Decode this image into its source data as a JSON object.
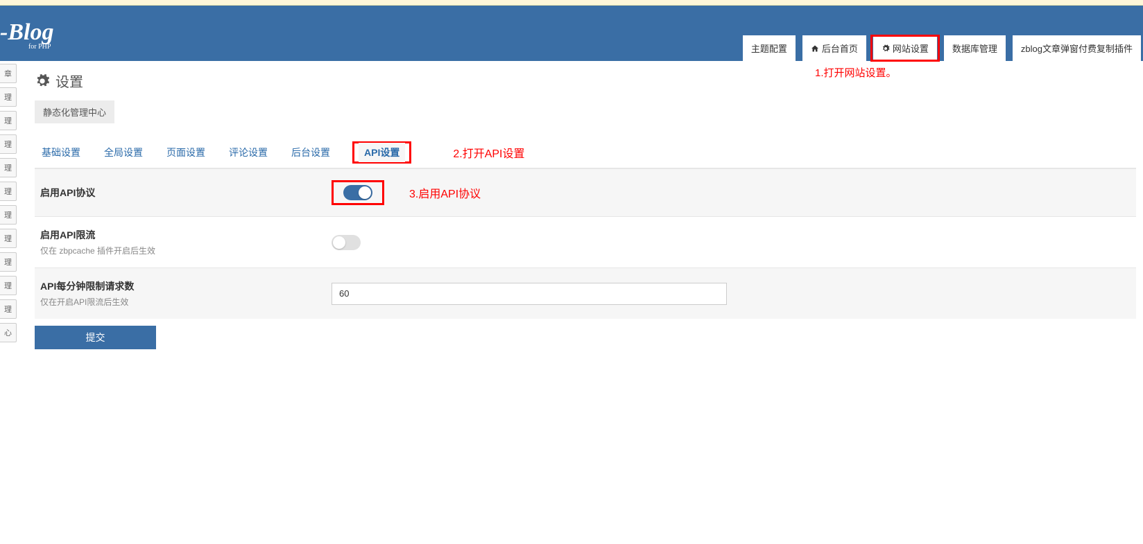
{
  "logo": {
    "main": "-Blog",
    "sub": "for PHP"
  },
  "topnav": [
    {
      "label": "主题配置",
      "icon": null
    },
    {
      "label": "后台首页",
      "icon": "home"
    },
    {
      "label": "网站设置",
      "icon": "gear",
      "highlight": true
    },
    {
      "label": "数据库管理",
      "icon": null
    },
    {
      "label": "zblog文章弹窗付费复制插件",
      "icon": null
    }
  ],
  "annotations": {
    "step1": "1.打开网站设置。",
    "step2": "2.打开API设置",
    "step3": "3.启用API协议"
  },
  "sidebar_items": [
    "章",
    "理",
    "理",
    "理",
    "理",
    "理",
    "理",
    "理",
    "理",
    "理",
    "理",
    "心"
  ],
  "page": {
    "title": "设置",
    "sub_button": "静态化管理中心"
  },
  "tabs": [
    {
      "label": "基础设置"
    },
    {
      "label": "全局设置"
    },
    {
      "label": "页面设置"
    },
    {
      "label": "评论设置"
    },
    {
      "label": "后台设置"
    },
    {
      "label": "API设置",
      "active": true
    }
  ],
  "form": {
    "row1": {
      "label": "启用API协议",
      "toggle": "on"
    },
    "row2": {
      "label": "启用API限流",
      "hint": "仅在 zbpcache 插件开启后生效",
      "toggle": "off"
    },
    "row3": {
      "label": "API每分钟限制请求数",
      "hint": "仅在开启API限流后生效",
      "value": "60"
    },
    "submit": "提交"
  }
}
